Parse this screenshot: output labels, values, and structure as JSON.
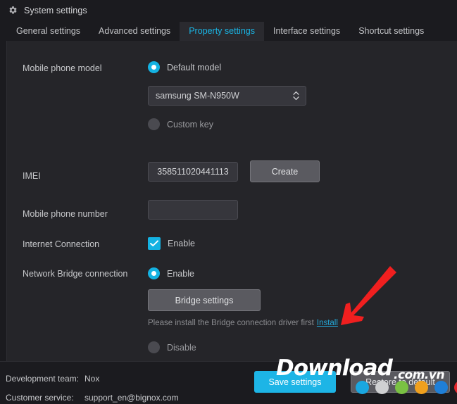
{
  "window": {
    "title": "System settings",
    "icon": "gear-icon"
  },
  "tabs": [
    {
      "label": "General settings",
      "active": false
    },
    {
      "label": "Advanced settings",
      "active": false
    },
    {
      "label": "Property settings",
      "active": true
    },
    {
      "label": "Interface settings",
      "active": false
    },
    {
      "label": "Shortcut settings",
      "active": false
    }
  ],
  "form": {
    "phone_model": {
      "label": "Mobile phone model",
      "default_option_label": "Default model",
      "default_option_selected": true,
      "model_select_value": "samsung SM-N950W",
      "custom_option_label": "Custom key",
      "custom_option_selected": false
    },
    "imei": {
      "label": "IMEI",
      "value": "358511020441113",
      "create_button": "Create"
    },
    "phone_number": {
      "label": "Mobile phone number",
      "value": "",
      "placeholder": ""
    },
    "internet_connection": {
      "label": "Internet Connection",
      "enable_label": "Enable",
      "enabled": true
    },
    "network_bridge": {
      "label": "Network Bridge connection",
      "enable_label": "Enable",
      "enable_selected": true,
      "bridge_settings_button": "Bridge settings",
      "hint_text": "Please install the Bridge connection driver first",
      "hint_link": "Install",
      "disable_label": "Disable",
      "disable_selected": false
    }
  },
  "footer": {
    "dev_team_label": "Development team:",
    "dev_team_value": "Nox",
    "customer_service_label": "Customer service:",
    "customer_service_value": "support_en@bignox.com",
    "save_button": "Save settings",
    "restore_button": "Restore to default"
  },
  "watermark": {
    "brand": "Download",
    "suffix": ".com.vn",
    "dot_colors": [
      "#1aa7e0",
      "#cfd0d2",
      "#7ac143",
      "#f0a01e",
      "#1f7fd8",
      "#e3242b"
    ]
  },
  "annotation": {
    "arrow_color": "#f01f1f",
    "arrow_points_to": "Install"
  },
  "colors": {
    "accent": "#1db5e6",
    "active_tab_text": "#19b6e6",
    "link": "#23a8d8",
    "panel_bg": "#252529",
    "window_bg": "#1b1b1f"
  }
}
